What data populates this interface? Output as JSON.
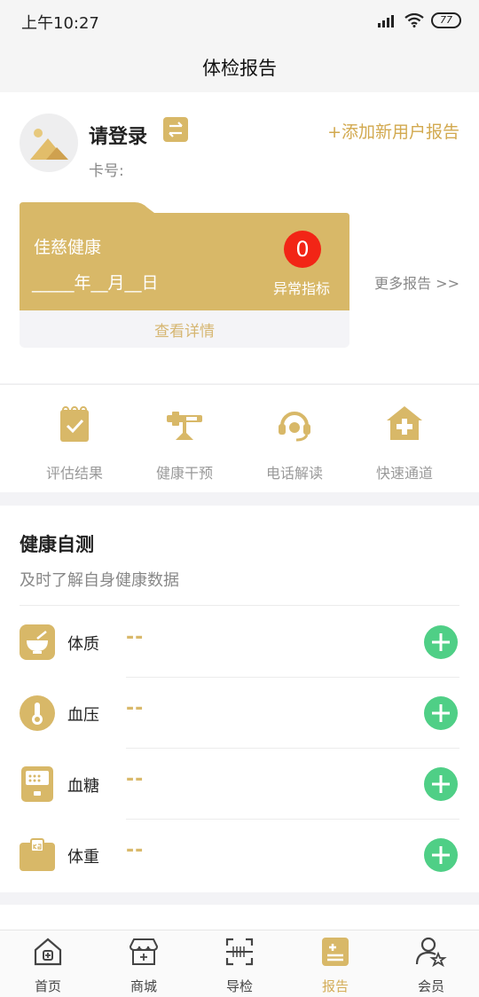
{
  "status_bar": {
    "time": "上午10:27",
    "battery": "77"
  },
  "nav": {
    "title": "体检报告"
  },
  "user": {
    "login_text": "请登录",
    "card_no_label": "卡号:",
    "add_user_label": "+添加新用户报告"
  },
  "report_card": {
    "name": "佳慈健康",
    "date_text": "_____年__月__日",
    "abnormal_count": "0",
    "abnormal_label": "异常指标",
    "view_details": "查看详情",
    "more_reports": "更多报告 >>"
  },
  "shortcuts": [
    {
      "label": "评估结果",
      "icon": "clipboard-check-icon"
    },
    {
      "label": "健康干预",
      "icon": "intervention-icon"
    },
    {
      "label": "电话解读",
      "icon": "headset-icon"
    },
    {
      "label": "快速通道",
      "icon": "medical-house-icon"
    }
  ],
  "self_test": {
    "title": "健康自测",
    "subtitle": "及时了解自身健康数据",
    "items": [
      {
        "name": "体质",
        "value": "--",
        "icon": "bowl-icon"
      },
      {
        "name": "血压",
        "value": "--",
        "icon": "thermometer-icon"
      },
      {
        "name": "血糖",
        "value": "--",
        "icon": "glucose-meter-icon"
      },
      {
        "name": "体重",
        "value": "--",
        "icon": "weight-kg-icon"
      }
    ]
  },
  "tabs": [
    {
      "label": "首页",
      "icon": "home-icon"
    },
    {
      "label": "商城",
      "icon": "store-icon"
    },
    {
      "label": "导检",
      "icon": "scan-icon"
    },
    {
      "label": "报告",
      "icon": "report-icon",
      "active": true
    },
    {
      "label": "会员",
      "icon": "member-icon"
    }
  ],
  "colors": {
    "gold": "#d8b868",
    "gold_text": "#d2a94f",
    "green": "#4fcf86",
    "red_badge": "#f22516"
  }
}
